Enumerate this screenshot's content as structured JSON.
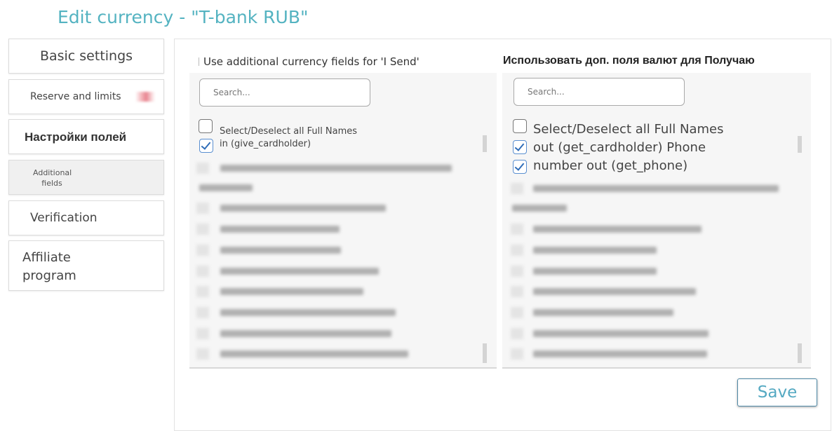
{
  "page_title": "Edit currency - \"T-bank RUB\"",
  "sidebar": {
    "items": [
      {
        "label": "Basic settings"
      },
      {
        "label": "Reserve and limits"
      },
      {
        "label": "Настройки полей"
      },
      {
        "label": "Additional fields"
      },
      {
        "label": "Verification"
      },
      {
        "label": "Affiliate program"
      }
    ]
  },
  "give_column": {
    "heading": "Use additional currency fields for 'I Send'",
    "search_placeholder": "Search...",
    "select_all_label": "Select/Deselect all Full Names",
    "select_all_checked": false,
    "checked_items": [
      {
        "label": "in (give_cardholder)",
        "checked": true
      }
    ]
  },
  "get_column": {
    "heading": "Использовать доп. поля валют для Получаю",
    "search_placeholder": "Search...",
    "select_all_label": "Select/Deselect all Full Names",
    "select_all_checked": false,
    "checked_items": [
      {
        "label": "out (get_cardholder) Phone",
        "checked": true
      },
      {
        "label": "number out (get_phone)",
        "checked": true
      }
    ]
  },
  "save_button": {
    "label": "Save"
  },
  "colors": {
    "title": "#54b3c1",
    "checkbox": "#2f6db8",
    "save_text": "#55a9c2",
    "save_border": "#4f89a6"
  }
}
